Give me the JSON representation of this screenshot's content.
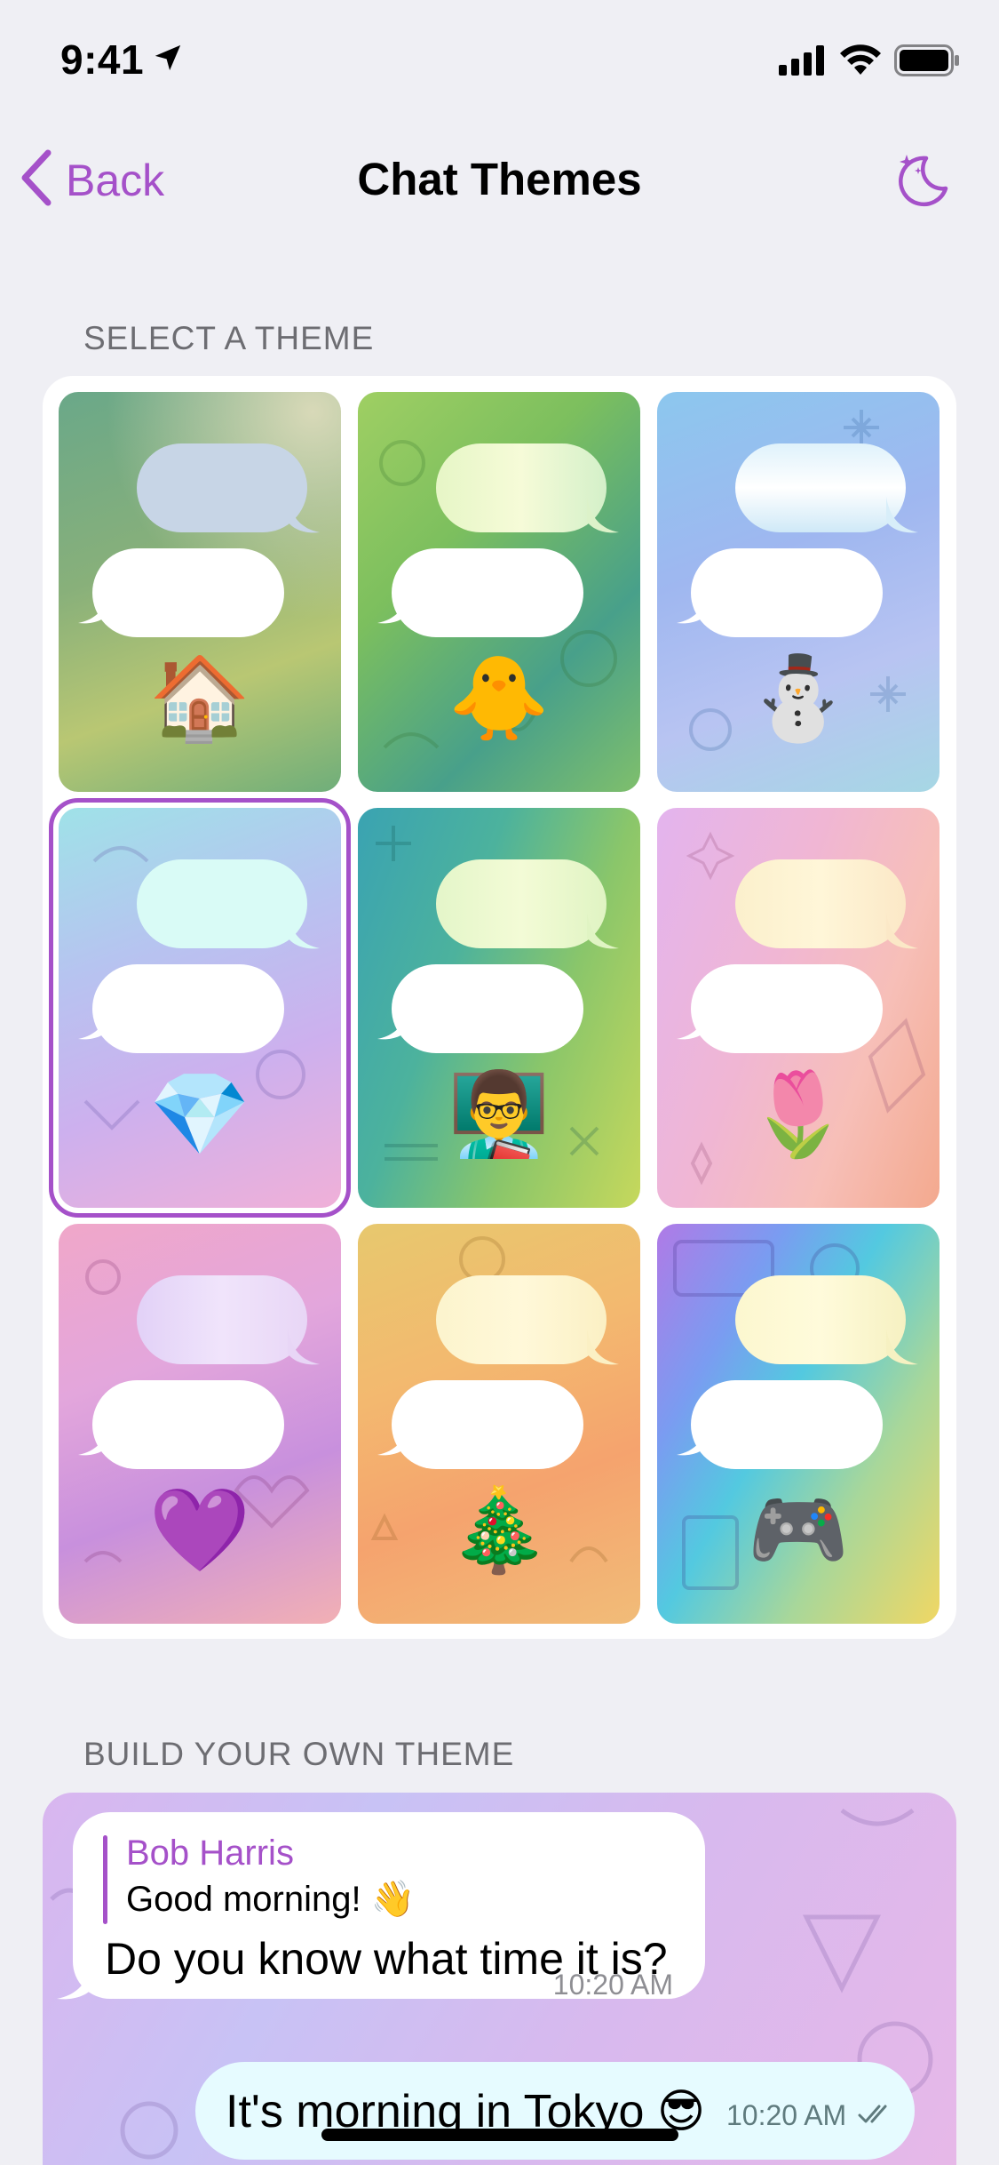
{
  "status_bar": {
    "time": "9:41"
  },
  "nav": {
    "back_label": "Back",
    "title": "Chat Themes"
  },
  "sections": {
    "themes_header": "SELECT A THEME",
    "build_header": "BUILD YOUR OWN THEME"
  },
  "themes": [
    {
      "emoji": "🏠",
      "selected": false
    },
    {
      "emoji": "🐥",
      "selected": false
    },
    {
      "emoji": "⛄",
      "selected": false
    },
    {
      "emoji": "💎",
      "selected": true
    },
    {
      "emoji": "👨‍🏫",
      "selected": false
    },
    {
      "emoji": "🌷",
      "selected": false
    },
    {
      "emoji": "💜",
      "selected": false
    },
    {
      "emoji": "🎄",
      "selected": false
    },
    {
      "emoji": "🎮",
      "selected": false
    }
  ],
  "preview": {
    "incoming": {
      "reply_name": "Bob Harris",
      "reply_text": "Good morning! 👋",
      "text": "Do you know what time it is?",
      "time": "10:20 AM"
    },
    "outgoing": {
      "text": "It's morning in Tokyo 😎",
      "time": "10:20 AM"
    }
  },
  "colors": {
    "accent": "#a551c9",
    "background": "#efeff4"
  }
}
